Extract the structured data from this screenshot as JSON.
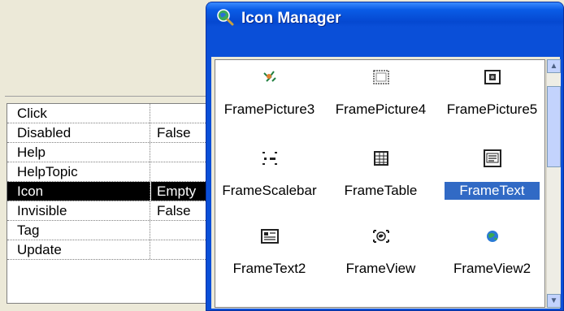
{
  "property_grid": {
    "rows": [
      {
        "name": "Click",
        "value": ""
      },
      {
        "name": "Disabled",
        "value": "False"
      },
      {
        "name": "Help",
        "value": ""
      },
      {
        "name": "HelpTopic",
        "value": ""
      },
      {
        "name": "Icon",
        "value": "Empty",
        "selected": true
      },
      {
        "name": "Invisible",
        "value": "False"
      },
      {
        "name": "Tag",
        "value": ""
      },
      {
        "name": "Update",
        "value": ""
      }
    ]
  },
  "icon_manager": {
    "title": "Icon Manager",
    "title_icon": "magnifier-globe-icon",
    "icons": [
      {
        "label": "FramePicture3",
        "icon": "frame-picture3-icon"
      },
      {
        "label": "FramePicture4",
        "icon": "frame-picture4-icon"
      },
      {
        "label": "FramePicture5",
        "icon": "frame-picture5-icon"
      },
      {
        "label": "FrameScalebar",
        "icon": "frame-scalebar-icon"
      },
      {
        "label": "FrameTable",
        "icon": "frame-table-icon"
      },
      {
        "label": "FrameText",
        "icon": "frame-text-icon",
        "selected": true
      },
      {
        "label": "FrameText2",
        "icon": "frame-text2-icon"
      },
      {
        "label": "FrameView",
        "icon": "frame-view-icon"
      },
      {
        "label": "FrameView2",
        "icon": "frame-view2-icon"
      }
    ],
    "colors": {
      "titlebar": "#0a4fd8",
      "selection": "#316ac5"
    }
  }
}
